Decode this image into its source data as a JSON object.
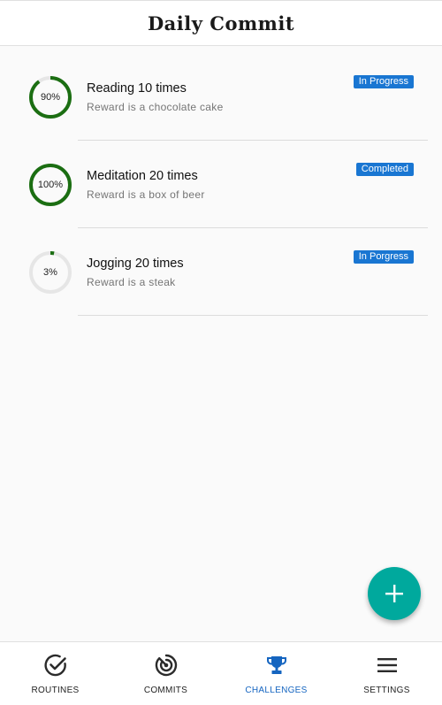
{
  "app": {
    "title": "Daily Commit"
  },
  "colors": {
    "progress": "#1b6e12",
    "track": "#e6e6e6",
    "badge": "#1976d2",
    "fab": "#00a99d",
    "active_nav": "#1565c0"
  },
  "challenges": [
    {
      "title": "Reading 10 times",
      "reward": "Reward is a chocolate cake",
      "progress": 0.9,
      "progress_label": "90%",
      "status": "In Progress"
    },
    {
      "title": "Meditation 20 times",
      "reward": "Reward is a box of beer",
      "progress": 1.0,
      "progress_label": "100%",
      "status": "Completed"
    },
    {
      "title": "Jogging 20 times",
      "reward": "Reward is a steak",
      "progress": 0.03,
      "progress_label": "3%",
      "status": "In Porgress"
    }
  ],
  "fab": {
    "icon": "plus-icon"
  },
  "bottom_nav": {
    "active": "challenges",
    "items": [
      {
        "id": "routines",
        "label": "ROUTINES",
        "icon": "check-circle-icon"
      },
      {
        "id": "commits",
        "label": "COMMITS",
        "icon": "target-icon"
      },
      {
        "id": "challenges",
        "label": "CHALLENGES",
        "icon": "trophy-icon"
      },
      {
        "id": "settings",
        "label": "SETTINGS",
        "icon": "menu-icon"
      }
    ]
  }
}
